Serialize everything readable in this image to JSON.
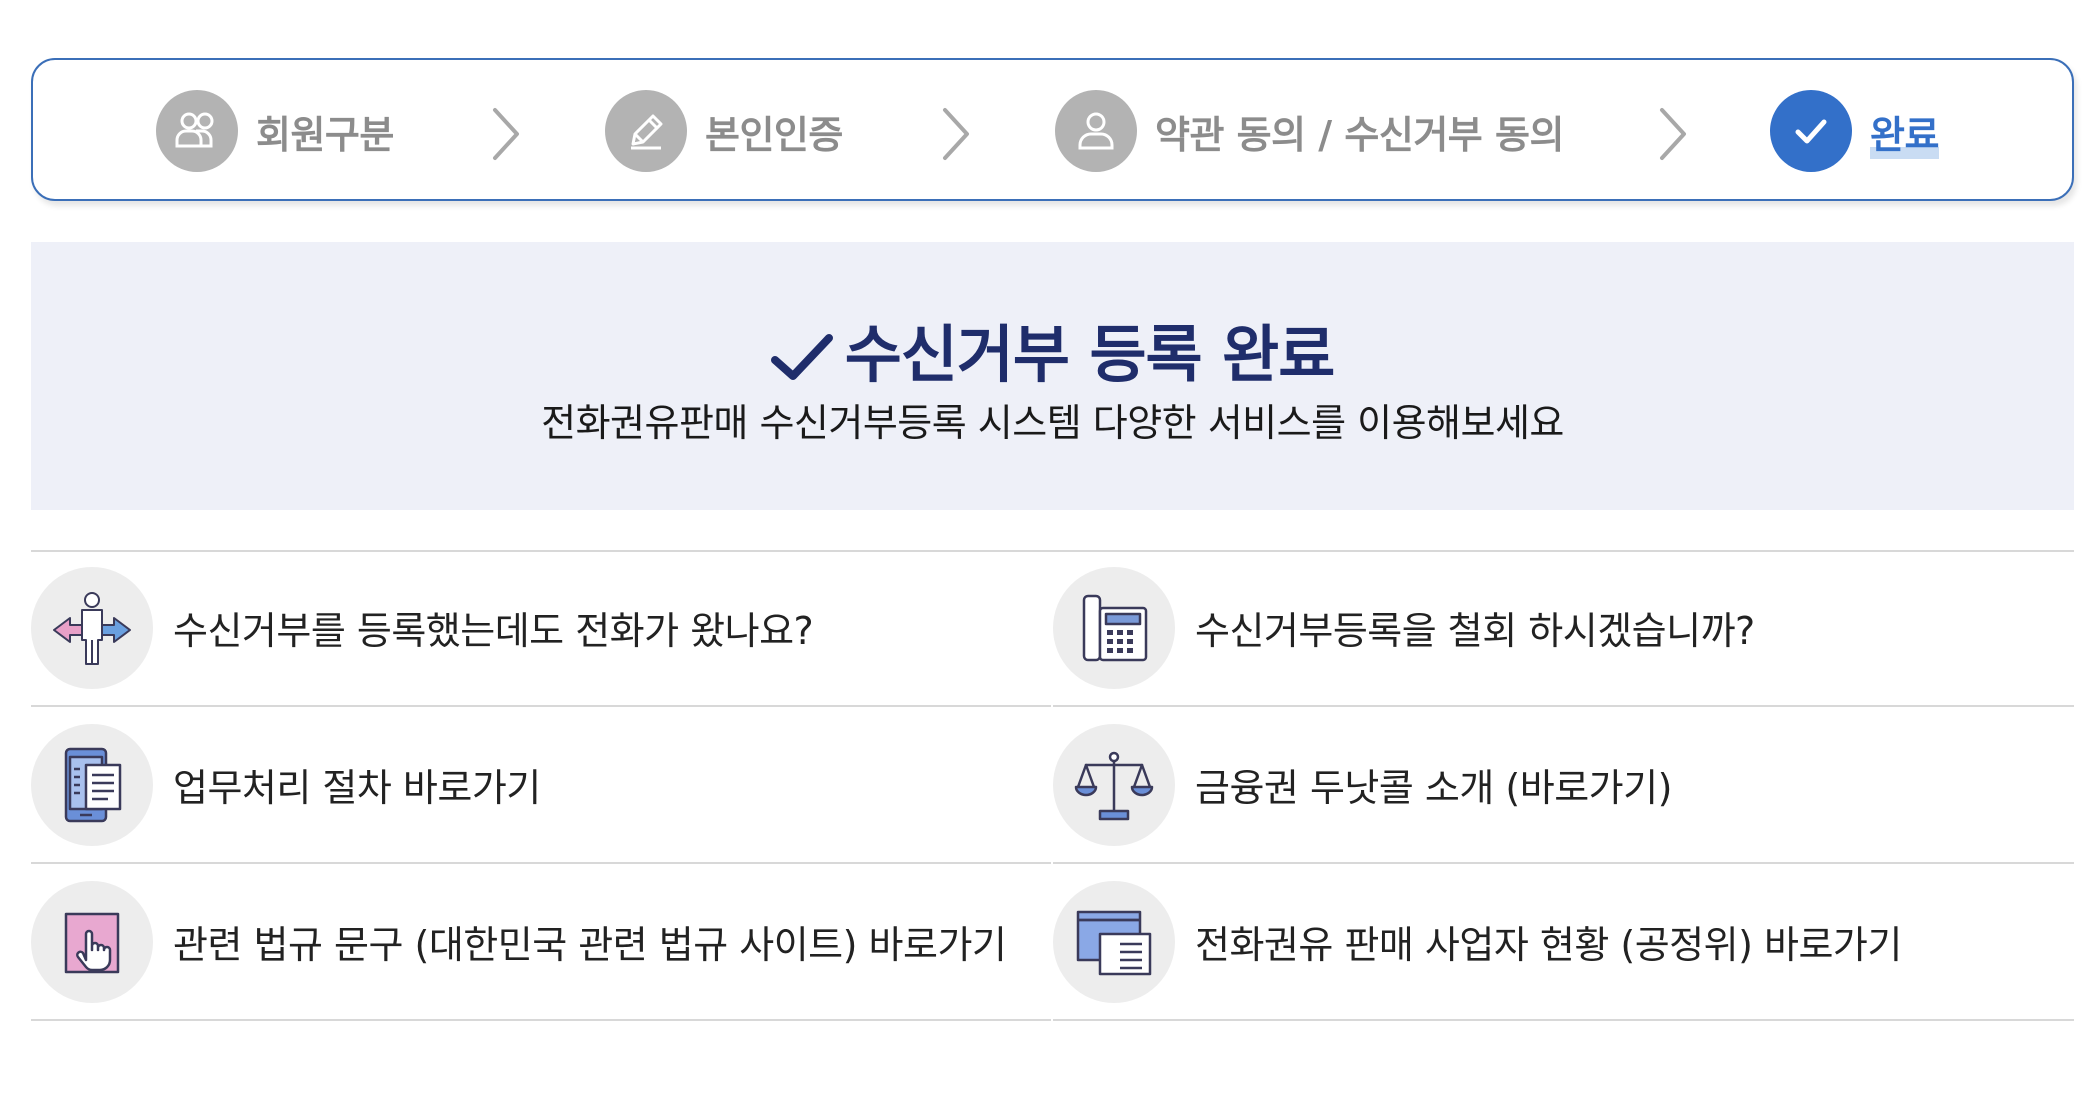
{
  "colors": {
    "accent": "#3370c9",
    "inactive": "#b3b3b3",
    "title_navy": "#1f2d6b",
    "banner_bg": "#eef0f8",
    "divider": "#d8d8d8"
  },
  "stepper": {
    "steps": [
      {
        "label": "회원구분",
        "icon": "group-icon",
        "state": "done"
      },
      {
        "label": "본인인증",
        "icon": "pencil-icon",
        "state": "done"
      },
      {
        "label": "약관 동의 / 수신거부 동의",
        "icon": "user-icon",
        "state": "done"
      },
      {
        "label": "완료",
        "icon": "check-icon",
        "state": "current"
      }
    ],
    "separator_icon": "chevron-right-icon"
  },
  "banner": {
    "icon": "check-icon",
    "title": "수신거부 등록 완료",
    "subtitle": "전화권유판매 수신거부등록 시스템 다양한 서비스를 이용해보세요"
  },
  "links": [
    {
      "label": "수신거부를 등록했는데도 전화가 왔나요?",
      "icon": "person-arrows-icon"
    },
    {
      "label": "수신거부등록을 철회 하시겠습니까?",
      "icon": "office-phone-icon"
    },
    {
      "label": "업무처리 절차 바로가기",
      "icon": "mobile-document-icon"
    },
    {
      "label": "금융권 두낫콜 소개 (바로가기)",
      "icon": "scales-icon"
    },
    {
      "label": "관련 법규 문구 (대한민국 관련 법규 사이트) 바로가기",
      "icon": "hand-pointer-icon"
    },
    {
      "label": "전화권유 판매 사업자 현황 (공정위) 바로가기",
      "icon": "browser-window-icon"
    }
  ]
}
